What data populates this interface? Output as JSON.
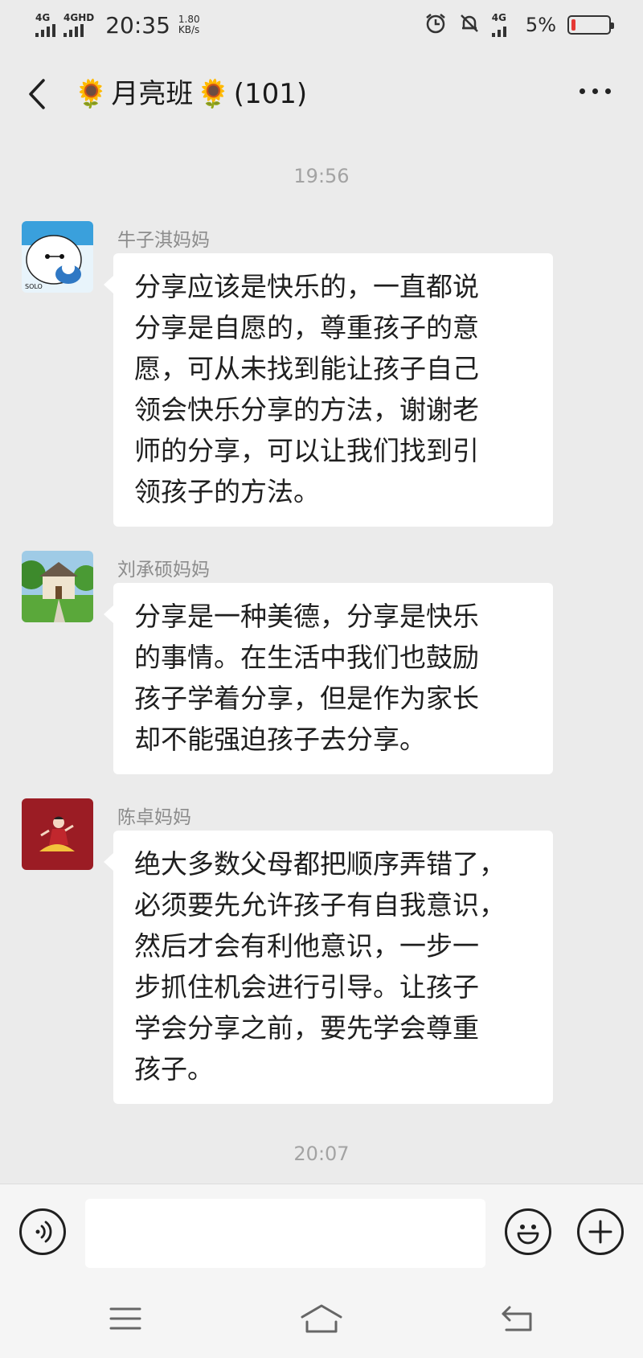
{
  "status_bar": {
    "network1": "4G",
    "network2": "4GHD",
    "time": "20:35",
    "speed_value": "1.80",
    "speed_unit": "KB/s",
    "network3": "4G",
    "battery_percent": "5%",
    "battery_level": 0.05,
    "battery_color": "#e53935",
    "icons": [
      "alarm-icon",
      "mute-icon"
    ]
  },
  "header": {
    "back_icon": "chevron-left-icon",
    "title_emoji": "🌻",
    "title_name": "月亮班",
    "member_count": "(101)",
    "more_icon": "ellipsis-icon"
  },
  "conversation": {
    "timestamps": [
      "19:56",
      "20:07"
    ],
    "messages": [
      {
        "sender": "牛子淇妈妈",
        "avatar": "baymax-avatar",
        "text": "分享应该是快乐的，一直都说\n分享是自愿的，尊重孩子的意\n愿，可从未找到能让孩子自己\n领会快乐分享的方法，谢谢老\n师的分享，可以让我们找到引\n领孩子的方法。"
      },
      {
        "sender": "刘承硕妈妈",
        "avatar": "house-avatar",
        "text": "分享是一种美德，分享是快乐\n的事情。在生活中我们也鼓励\n孩子学着分享，但是作为家长\n却不能强迫孩子去分享。"
      },
      {
        "sender": "陈卓妈妈",
        "avatar": "girl-avatar",
        "text": "绝大多数父母都把顺序弄错了，\n必须要先允许孩子有自我意识，\n然后才会有利他意识，一步一\n步抓住机会进行引导。让孩子\n学会分享之前，要先学会尊重\n孩子。"
      }
    ]
  },
  "input_bar": {
    "voice_icon": "voice-icon",
    "input_value": "",
    "emoji_icon": "emoji-icon",
    "add_icon": "plus-icon"
  },
  "nav_bar": {
    "icons": [
      "menu-icon",
      "home-icon",
      "back-icon"
    ]
  }
}
